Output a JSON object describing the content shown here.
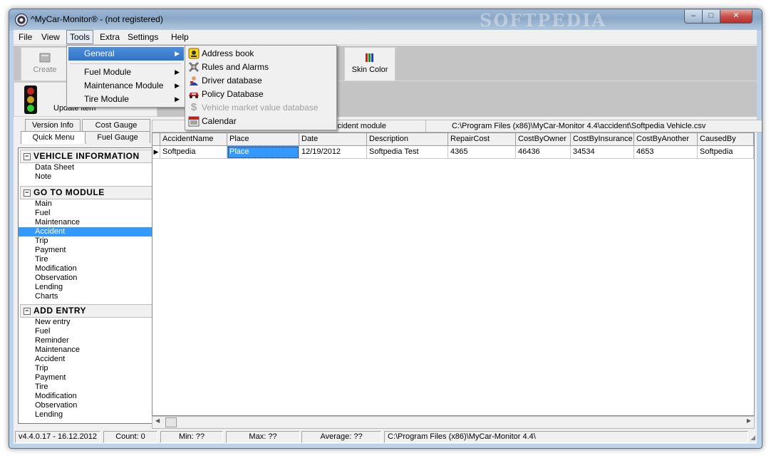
{
  "window": {
    "title": "^MyCar-Monitor® - (not registered)",
    "watermark": "SOFTPEDIA",
    "controls": {
      "minimize": "–",
      "maximize": "□",
      "close": "✕"
    }
  },
  "menubar": {
    "items": [
      "File",
      "View",
      "Tools",
      "Extra",
      "Settings",
      "Help"
    ]
  },
  "toolbar": {
    "buttons": [
      {
        "label": "Create",
        "icon": "create-icon",
        "disabled": true
      },
      {
        "label": "Skin Color",
        "icon": "skin-color-icon"
      }
    ]
  },
  "toolbar2": {
    "update_label": "Update item",
    "icon": "traffic-light-icon",
    "colors": {
      "red": "#c0271e",
      "yellow": "#c8a21e",
      "green": "#2fce2f"
    }
  },
  "tabs": {
    "row1": [
      "Version Info",
      "Cost Gauge"
    ],
    "row2": [
      "Quick Menu",
      "Fuel Gauge"
    ]
  },
  "sidebar": {
    "sections": [
      {
        "title": "VEHICLE INFORMATION",
        "items": [
          "Data Sheet",
          "Note"
        ]
      },
      {
        "title": "GO TO MODULE",
        "items": [
          "Main",
          "Fuel",
          "Maintenance",
          "Accident",
          "Trip",
          "Payment",
          "Tire",
          "Modification",
          "Observation",
          "Lending",
          "Charts"
        ],
        "selected": "Accident"
      },
      {
        "title": "ADD ENTRY",
        "items": [
          "New entry",
          "Fuel",
          "Reminder",
          "Maintenance",
          "Accident",
          "Trip",
          "Payment",
          "Tire",
          "Modification",
          "Observation",
          "Lending"
        ]
      }
    ]
  },
  "pathbar": {
    "module": "ccident module",
    "file_path": "C:\\Program Files (x86)\\MyCar-Monitor 4.4\\accident\\Softpedia Vehicle.csv"
  },
  "grid": {
    "columns": [
      "AccidentName",
      "Place",
      "Date",
      "Description",
      "RepairCost",
      "CostByOwner",
      "CostByInsurance",
      "CostByAnother",
      "CausedBy"
    ],
    "rows": [
      [
        "Softpedia",
        "Place",
        "12/19/2012",
        "Softpedia Test",
        "4365",
        "46436",
        "34534",
        "4653",
        "Softpedia"
      ]
    ],
    "focused_cell": "Place"
  },
  "statusbar": {
    "version": "v4.4.0.17 - 16.12.2012",
    "count": "Count: 0",
    "min": "Min: ??",
    "max": "Max: ??",
    "average": "Average: ??",
    "path": "C:\\Program Files (x86)\\MyCar-Monitor 4.4\\"
  },
  "tools_menu": {
    "items": [
      "General",
      "Fuel Module",
      "Maintenance Module",
      "Tire Module"
    ],
    "highlighted": "General"
  },
  "general_submenu": {
    "items": [
      {
        "label": "Address book",
        "icon": "address-book-icon",
        "enabled": true
      },
      {
        "label": "Rules and Alarms",
        "icon": "rules-alarms-icon",
        "enabled": true
      },
      {
        "label": "Driver database",
        "icon": "driver-icon",
        "enabled": true
      },
      {
        "label": "Policy Database",
        "icon": "policy-car-icon",
        "enabled": true
      },
      {
        "label": "Vehicle market value database",
        "icon": "dollar-icon",
        "enabled": false
      },
      {
        "label": "Calendar",
        "icon": "calendar-icon",
        "enabled": true
      }
    ]
  },
  "colors": {
    "selection": "#3399ff",
    "toolbar_bg": "#c4c4c4",
    "window_frame": "#bcd3ea"
  }
}
